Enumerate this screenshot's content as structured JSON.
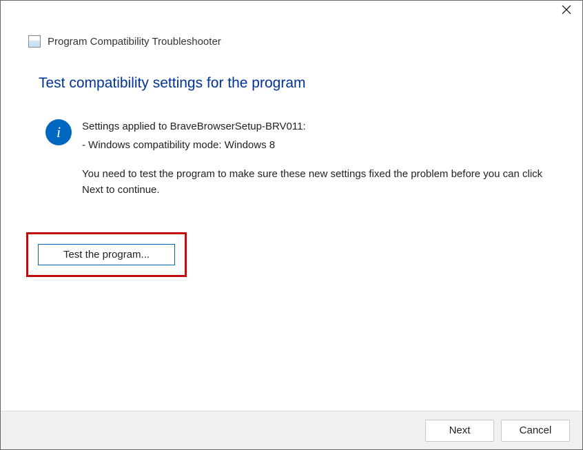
{
  "titlebar": {
    "close_icon": "close"
  },
  "header": {
    "title": "Program Compatibility Troubleshooter"
  },
  "content": {
    "heading": "Test compatibility settings for the program",
    "info": {
      "line1": "Settings applied to BraveBrowserSetup-BRV011:",
      "line2": "- Windows compatibility mode: Windows 8",
      "instruction": "You need to test the program to make sure these new settings fixed the problem before you can click Next to continue."
    }
  },
  "buttons": {
    "test": "Test the program...",
    "next": "Next",
    "cancel": "Cancel"
  }
}
